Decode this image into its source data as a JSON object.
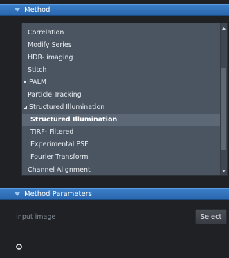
{
  "method_panel": {
    "title": "Method",
    "items": [
      {
        "label": "Correlation",
        "level": 0,
        "expander": "none",
        "selected": false
      },
      {
        "label": "Modify Series",
        "level": 0,
        "expander": "none",
        "selected": false
      },
      {
        "label": "HDR- imaging",
        "level": 0,
        "expander": "none",
        "selected": false
      },
      {
        "label": "Stitch",
        "level": 0,
        "expander": "none",
        "selected": false
      },
      {
        "label": "PALM",
        "level": 0,
        "expander": "collapsed",
        "selected": false
      },
      {
        "label": "Particle Tracking",
        "level": 0,
        "expander": "none",
        "selected": false
      },
      {
        "label": "Structured Illumination",
        "level": 0,
        "expander": "expanded",
        "selected": false
      },
      {
        "label": "Structured Illumination",
        "level": 1,
        "expander": "none",
        "selected": true
      },
      {
        "label": "TIRF- Filtered",
        "level": 1,
        "expander": "none",
        "selected": false
      },
      {
        "label": "Experimental PSF",
        "level": 1,
        "expander": "none",
        "selected": false
      },
      {
        "label": "Fourier Transform",
        "level": 1,
        "expander": "none",
        "selected": false
      },
      {
        "label": "Channel Alignment",
        "level": 0,
        "expander": "none",
        "selected": false
      }
    ]
  },
  "params_panel": {
    "title": "Method Parameters",
    "input_label": "Input image",
    "select_label": "Select"
  },
  "colors": {
    "header": "#2f72bd",
    "list_bg": "#4b5561",
    "selected_bg": "#5c6876",
    "panel_bg": "#1f2124"
  },
  "icons": {
    "header_chevron": "chevron-down-icon",
    "collapsed": "triangle-right-icon",
    "expanded": "triangle-down-icon",
    "info": "info-icon"
  }
}
